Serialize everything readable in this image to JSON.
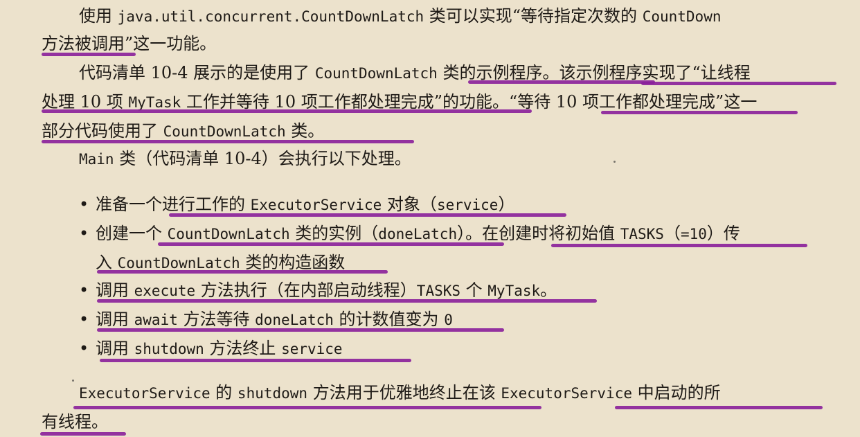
{
  "paragraphs": {
    "p1": {
      "l1": [
        "使用 ",
        "java.util.concurrent.CountDownLatch",
        " 类可以实现“等待指定次数的 ",
        "CountDown"
      ],
      "l2": "方法被调用”这一功能。"
    },
    "p2": {
      "l1": [
        "代码清单 10-4 展示的是使用了 ",
        "CountDownLatch",
        " 类的示例程序。该示例程序实现了“让线程"
      ],
      "l2": [
        "处理 10 项 ",
        "MyTask",
        " 工作并等待 10 项工作都处理完成”的功能。“等待 10 项工作都处理完成”这一"
      ],
      "l3": [
        "部分代码使用了 ",
        "CountDownLatch",
        " 类。"
      ]
    },
    "p3": {
      "l1": [
        "Main",
        " 类（代码清单 10-4）会执行以下处理。"
      ]
    },
    "bullets": [
      {
        "parts": [
          "准备一个进行工作的 ",
          "ExecutorService",
          " 对象（",
          "service",
          "）"
        ]
      },
      {
        "parts": [
          "创建一个 ",
          "CountDownLatch",
          " 类的实例（",
          "doneLatch",
          "）。在创建时将初始值 ",
          "TASKS",
          "（",
          "=10",
          "）传"
        ],
        "cont": [
          "入 ",
          "CountDownLatch",
          " 类的构造函数"
        ]
      },
      {
        "parts": [
          "调用 ",
          "execute",
          " 方法执行（在内部启动线程）",
          "TASKS",
          " 个 ",
          "MyTask",
          "。"
        ]
      },
      {
        "parts": [
          "调用 ",
          "await",
          " 方法等待 ",
          "doneLatch",
          " 的计数值变为 ",
          "0"
        ]
      },
      {
        "parts": [
          "调用 ",
          "shutdown",
          " 方法终止 ",
          "service"
        ]
      }
    ],
    "p4": {
      "l1": [
        "ExecutorService",
        " 的 ",
        "shutdown",
        " 方法用于优雅地终止在该 ",
        "ExecutorService",
        " 中启动的所"
      ],
      "l2": "有线程。"
    }
  },
  "bullet_symbol": "•",
  "colors": {
    "page": "#ece2cc",
    "text": "#1e1a16",
    "highlight": "#8a1f9a"
  }
}
